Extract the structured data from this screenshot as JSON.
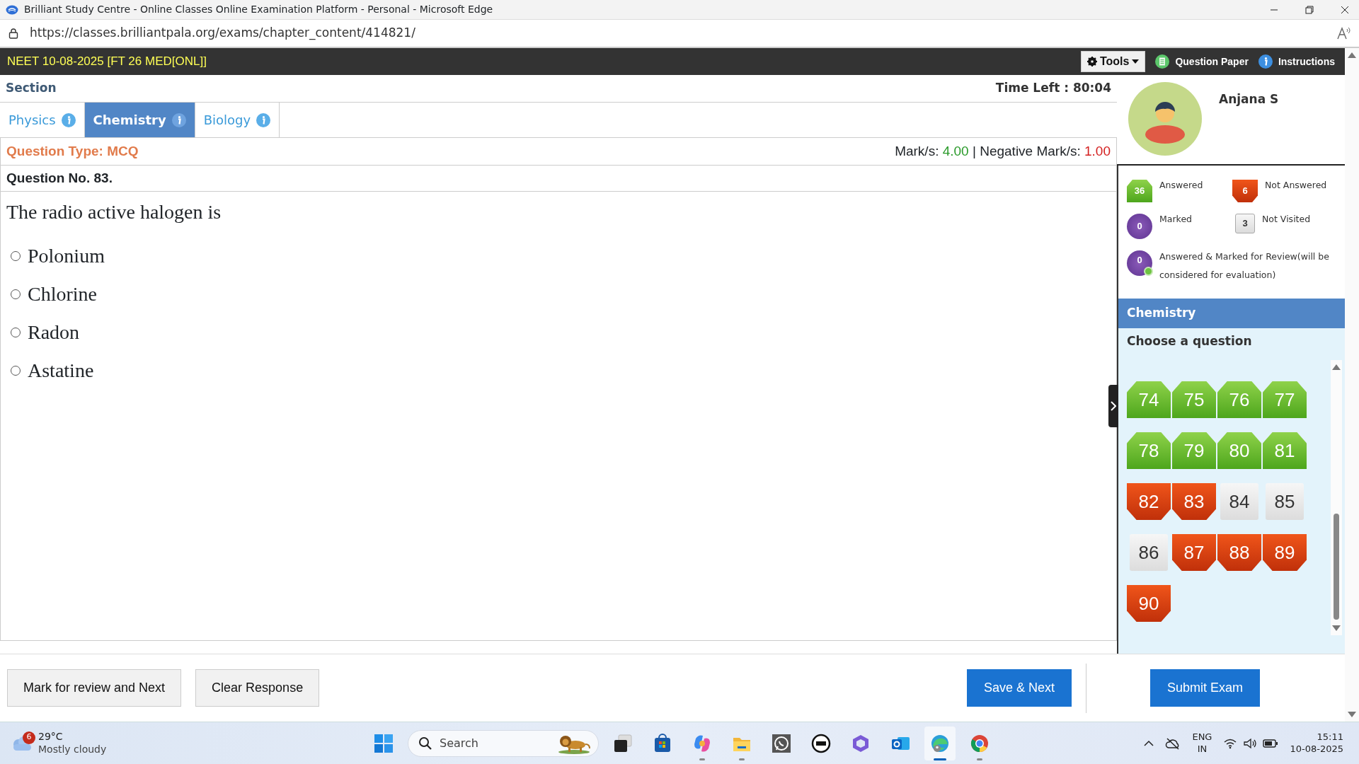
{
  "window": {
    "title": "Brilliant Study Centre - Online Classes Online Examination Platform - Personal - Microsoft Edge"
  },
  "browser": {
    "url": "https://classes.brilliantpala.org/exams/chapter_content/414821/"
  },
  "exam_header": {
    "title": "NEET 10-08-2025 [FT 26 MED[ONL]]",
    "tools": "Tools",
    "question_paper": "Question Paper",
    "instructions": "Instructions"
  },
  "section_label": "Section",
  "time_left": {
    "label": "Time Left :",
    "value": "80:04"
  },
  "tabs": [
    {
      "label": "Physics",
      "selected": false
    },
    {
      "label": "Chemistry",
      "selected": true
    },
    {
      "label": "Biology",
      "selected": false
    }
  ],
  "question_type": "Question Type: MCQ",
  "marks": {
    "mark_label": "Mark/s:",
    "mark_value": "4.00",
    "separator": "|",
    "negative_label": "Negative Mark/s:",
    "negative_value": "1.00"
  },
  "question_number": "Question No. 83.",
  "question_text": "The radio active halogen is",
  "options": [
    {
      "label": "Polonium",
      "selected": false
    },
    {
      "label": "Chlorine",
      "selected": false
    },
    {
      "label": "Radon",
      "selected": false
    },
    {
      "label": "Astatine",
      "selected": false
    }
  ],
  "candidate": {
    "name": "Anjana S"
  },
  "legend": [
    {
      "kind": "answered",
      "count": "36",
      "label": "Answered"
    },
    {
      "kind": "not_answered",
      "count": "6",
      "label": "Not Answered"
    },
    {
      "kind": "marked",
      "count": "0",
      "label": "Marked"
    },
    {
      "kind": "not_visited",
      "count": "3",
      "label": "Not Visited"
    },
    {
      "kind": "answered_marked",
      "count": "0",
      "label": "Answered & Marked for Review(will be considered for evaluation)"
    }
  ],
  "palette": {
    "section_title": "Chemistry",
    "prompt": "Choose a question",
    "questions": [
      {
        "number": "74",
        "kind": "answered"
      },
      {
        "number": "75",
        "kind": "answered"
      },
      {
        "number": "76",
        "kind": "answered"
      },
      {
        "number": "77",
        "kind": "answered"
      },
      {
        "number": "78",
        "kind": "answered"
      },
      {
        "number": "79",
        "kind": "answered"
      },
      {
        "number": "80",
        "kind": "answered"
      },
      {
        "number": "81",
        "kind": "answered"
      },
      {
        "number": "82",
        "kind": "not_answered"
      },
      {
        "number": "83",
        "kind": "not_answered"
      },
      {
        "number": "84",
        "kind": "not_visited"
      },
      {
        "number": "85",
        "kind": "not_visited"
      },
      {
        "number": "86",
        "kind": "not_visited"
      },
      {
        "number": "87",
        "kind": "not_answered"
      },
      {
        "number": "88",
        "kind": "not_answered"
      },
      {
        "number": "89",
        "kind": "not_answered"
      },
      {
        "number": "90",
        "kind": "not_answered"
      }
    ]
  },
  "buttons": {
    "mark_review": "Mark for review and Next",
    "clear": "Clear Response",
    "save_next": "Save & Next",
    "submit": "Submit Exam"
  },
  "taskbar": {
    "weather": {
      "badge": "6",
      "temperature": "29°C",
      "condition": "Mostly cloudy"
    },
    "search_placeholder": "Search",
    "apps": [
      {
        "kind": "start",
        "running": false,
        "active": false
      },
      {
        "kind": "taskview",
        "running": false,
        "active": false
      },
      {
        "kind": "store",
        "running": false,
        "active": false
      },
      {
        "kind": "copilot",
        "running": true,
        "active": false
      },
      {
        "kind": "files",
        "running": true,
        "active": false
      },
      {
        "kind": "whatsapp",
        "running": false,
        "active": false
      },
      {
        "kind": "dell",
        "running": false,
        "active": false
      },
      {
        "kind": "m365",
        "running": false,
        "active": false
      },
      {
        "kind": "outlook",
        "running": false,
        "active": false
      },
      {
        "kind": "edge",
        "running": true,
        "active": true
      },
      {
        "kind": "chrome",
        "running": true,
        "active": false
      }
    ],
    "language": "ENG",
    "region": "IN",
    "time": "15:11",
    "date": "10-08-2025"
  }
}
